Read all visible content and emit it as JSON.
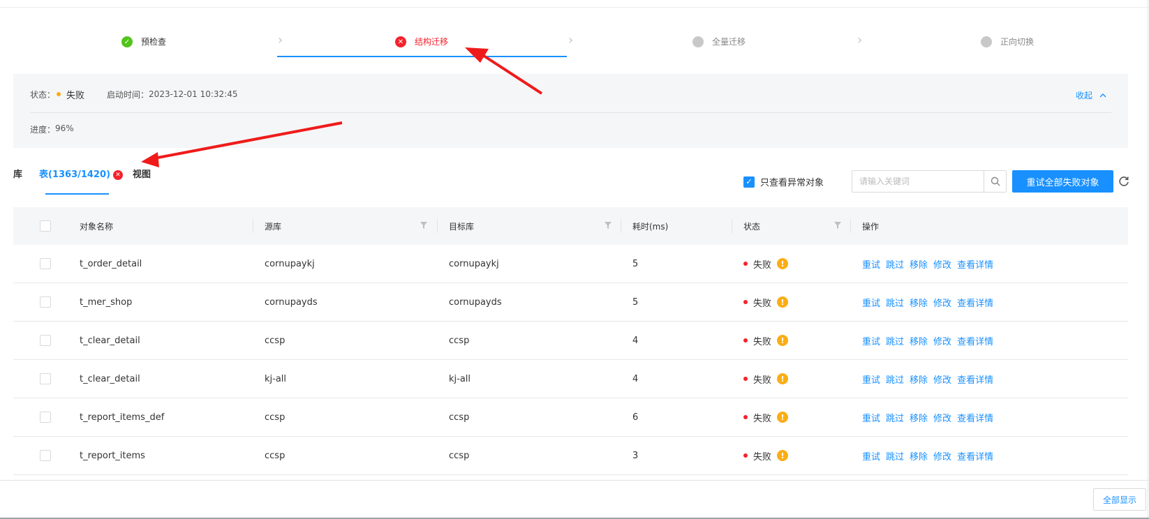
{
  "steps": [
    {
      "label": "预检查",
      "state": "done"
    },
    {
      "label": "结构迁移",
      "state": "failed"
    },
    {
      "label": "全量迁移",
      "state": "pending"
    },
    {
      "label": "正向切换",
      "state": "pending"
    }
  ],
  "status_panel": {
    "status_label": "状态：",
    "status_value": "失败",
    "start_label": "启动时间：",
    "start_value": "2023-12-01 10:32:45",
    "collapse_label": "收起",
    "progress_label": "进度：",
    "progress_value": "96%"
  },
  "tabs": [
    {
      "label": "库"
    },
    {
      "label": "表(1363/1420)"
    },
    {
      "label": "视图"
    }
  ],
  "toolbar": {
    "only_abnormal_label": "只查看异常对象",
    "only_abnormal_checked": true,
    "search_placeholder": "请输入关键词",
    "retry_all_label": "重试全部失败对象"
  },
  "table": {
    "columns": [
      "对象名称",
      "源库",
      "目标库",
      "耗时(ms)",
      "状态",
      "操作"
    ],
    "rows": [
      {
        "name": "t_order_detail",
        "source": "cornupaykj",
        "target": "cornupaykj",
        "time": "5",
        "status": "失败"
      },
      {
        "name": "t_mer_shop",
        "source": "cornupayds",
        "target": "cornupayds",
        "time": "5",
        "status": "失败"
      },
      {
        "name": "t_clear_detail",
        "source": "ccsp",
        "target": "ccsp",
        "time": "4",
        "status": "失败"
      },
      {
        "name": "t_clear_detail",
        "source": "kj-all",
        "target": "kj-all",
        "time": "4",
        "status": "失败"
      },
      {
        "name": "t_report_items_def",
        "source": "ccsp",
        "target": "ccsp",
        "time": "6",
        "status": "失败"
      },
      {
        "name": "t_report_items",
        "source": "ccsp",
        "target": "ccsp",
        "time": "3",
        "status": "失败"
      }
    ],
    "actions": [
      "重试",
      "跳过",
      "移除",
      "修改",
      "查看详情"
    ]
  },
  "footer": {
    "show_all_label": "全部显示"
  },
  "colors": {
    "primary": "#1890ff",
    "error": "#f5222d",
    "success": "#52c41a",
    "warning": "#faad14",
    "annotation_arrow": "#ef1b1b"
  },
  "icons": [
    "check-icon",
    "error-icon",
    "pending-icon",
    "chevron-right-icon",
    "chevron-up-icon",
    "search-icon",
    "refresh-icon",
    "filter-icon",
    "warning-icon"
  ]
}
